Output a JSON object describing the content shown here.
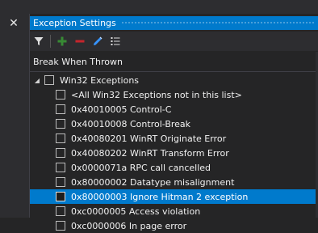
{
  "panel": {
    "title": "Exception Settings",
    "close_glyph": "✕"
  },
  "toolbar": {
    "buttons": [
      {
        "icon": "filter-icon"
      },
      {
        "icon": "add-icon"
      },
      {
        "icon": "remove-icon"
      },
      {
        "icon": "edit-icon"
      },
      {
        "icon": "list-options-icon"
      }
    ]
  },
  "grid": {
    "column_header": "Break When Thrown",
    "group": {
      "expander_glyph": "◢",
      "label": "Win32 Exceptions"
    },
    "items": [
      {
        "label": "<All Win32 Exceptions not in this list>"
      },
      {
        "label": "0x40010005 Control-C"
      },
      {
        "label": "0x40010008 Control-Break"
      },
      {
        "label": "0x40080201 WinRT Originate Error"
      },
      {
        "label": "0x40080202 WinRT Transform Error"
      },
      {
        "label": "0x0000071a RPC call cancelled"
      },
      {
        "label": "0x80000002 Datatype misalignment"
      },
      {
        "label": "0x80000003 Ignore Hitman 2 exception",
        "selected": true
      },
      {
        "label": "0xc0000005 Access violation"
      },
      {
        "label": "0xc0000006 In page error"
      }
    ]
  },
  "colors": {
    "accent": "#007acc",
    "background": "#252526",
    "toolbar": "#2d2d30",
    "add_icon": "#388a34",
    "remove_icon": "#c5252c",
    "edit_icon": "#3794ff"
  }
}
